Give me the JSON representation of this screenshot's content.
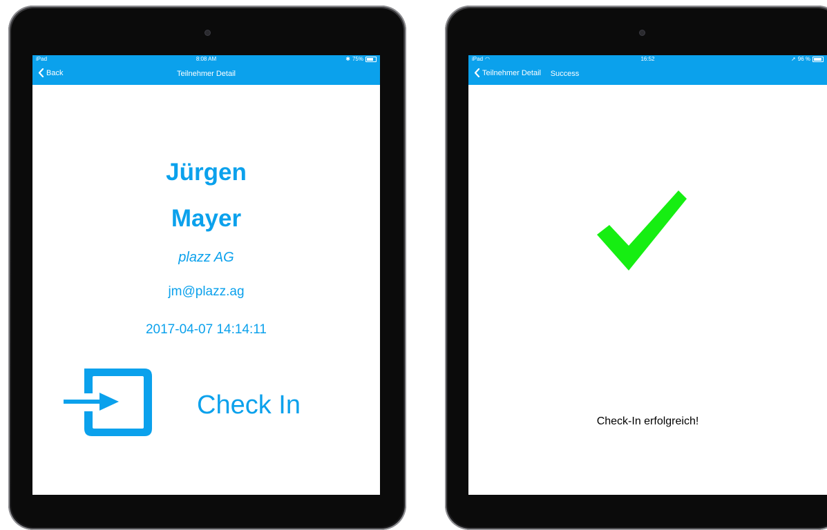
{
  "left_screen": {
    "status": {
      "carrier": "iPad",
      "time": "8:08 AM",
      "battery": "75%"
    },
    "nav": {
      "back_label": "Back",
      "title": "Teilnehmer Detail"
    },
    "participant": {
      "first_name": "Jürgen",
      "last_name": "Mayer",
      "company": "plazz AG",
      "email": "jm@plazz.ag",
      "timestamp": "2017-04-07 14:14:11"
    },
    "checkin_label": "Check In",
    "icons": {
      "checkin": "login-arrow-icon",
      "back": "chevron-left-icon"
    },
    "accent": "#0ba1ec"
  },
  "right_screen": {
    "status": {
      "carrier": "iPad",
      "time": "16:52",
      "battery": "96 %"
    },
    "nav": {
      "back_label": "Teilnehmer Detail",
      "title": "Success"
    },
    "icons": {
      "success": "checkmark-icon"
    },
    "success_color": "#16ee12",
    "message": "Check-In erfolgreich!"
  }
}
